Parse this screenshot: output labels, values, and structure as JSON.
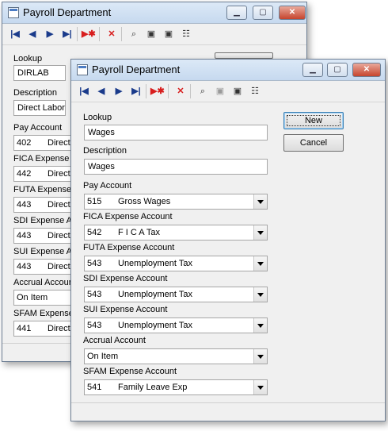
{
  "back_window": {
    "title": "Payroll Department",
    "fields": {
      "lookup_label": "Lookup",
      "lookup_value": "DIRLAB",
      "description_label": "Description",
      "description_value": "Direct Labor",
      "pay_account_label": "Pay Account",
      "pay_account_code": "402",
      "pay_account_desc": "Direct",
      "fica_label": "FICA Expense",
      "fica_code": "442",
      "fica_desc": "Direct",
      "futa_label": "FUTA Expense",
      "futa_code": "443",
      "futa_desc": "Direct",
      "sdi_label": "SDI Expense A",
      "sdi_code": "443",
      "sdi_desc": "Direct",
      "sui_label": "SUI Expense A",
      "sui_code": "443",
      "sui_desc": "Direct",
      "accrual_label": "Accrual Accoun",
      "accrual_value": "On Item",
      "sfam_label": "SFAM Expense",
      "sfam_code": "441",
      "sfam_desc": "Direct"
    }
  },
  "front_window": {
    "title": "Payroll Department",
    "buttons": {
      "new": "New",
      "cancel": "Cancel"
    },
    "fields": {
      "lookup_label": "Lookup",
      "lookup_value": "Wages",
      "description_label": "Description",
      "description_value": "Wages",
      "pay_account_label": "Pay Account",
      "pay_account_code": "515",
      "pay_account_desc": "Gross Wages",
      "fica_label": "FICA Expense Account",
      "fica_code": "542",
      "fica_desc": "F I C A Tax",
      "futa_label": "FUTA Expense Account",
      "futa_code": "543",
      "futa_desc": "Unemployment Tax",
      "sdi_label": "SDI Expense Account",
      "sdi_code": "543",
      "sdi_desc": "Unemployment Tax",
      "sui_label": "SUI Expense Account",
      "sui_code": "543",
      "sui_desc": "Unemployment Tax",
      "accrual_label": "Accrual Account",
      "accrual_value": "On Item",
      "sfam_label": "SFAM Expense Account",
      "sfam_code": "541",
      "sfam_desc": "Family Leave Exp"
    }
  },
  "toolbar_icons": [
    "first-record-icon",
    "previous-record-icon",
    "next-record-icon",
    "last-record-icon",
    "new-record-icon",
    "delete-record-icon",
    "find-icon",
    "save-icon",
    "save-close-icon",
    "properties-icon"
  ],
  "colors": {
    "titlebar": "#dce9f7",
    "window_bg": "#f0f0f0",
    "nav_icon": "#1a3b8b",
    "delete_icon": "#d81e1e"
  }
}
